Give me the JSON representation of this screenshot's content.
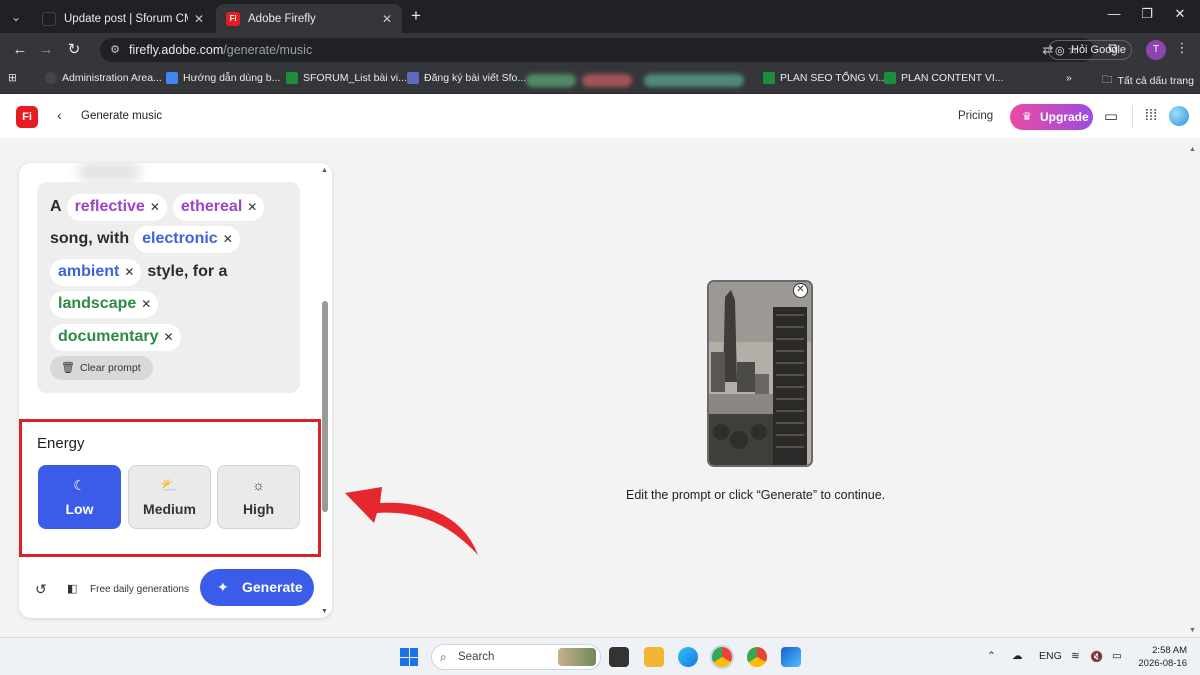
{
  "browser": {
    "tabs": [
      {
        "title": "Update post | Sforum CMS",
        "active": false
      },
      {
        "title": "Adobe Firefly",
        "active": true
      }
    ],
    "tab_favicon_ff": "Fi",
    "url_domain": "firefly.adobe.com",
    "url_path": "/generate/music",
    "ask_google": "Hỏi Google",
    "profile_initial": "T",
    "bookmarks": [
      "Administration Area...",
      "Hướng dẫn dùng b...",
      "SFORUM_List bài vi...",
      "Đăng ký bài viết Sfo...",
      "PLAN SEO TỔNG VI...",
      "PLAN CONTENT VI..."
    ],
    "bookmarks_more": "»",
    "all_bookmarks": "Tất cả dấu trang"
  },
  "app": {
    "logo": "Fi",
    "page_title": "Generate music",
    "pricing": "Pricing",
    "upgrade": "Upgrade"
  },
  "prompt": {
    "line1_word": "A",
    "chip_reflective": "reflective",
    "chip_ethereal": "ethereal",
    "line2_word": "song, with",
    "chip_electronic": "electronic",
    "chip_ambient": "ambient",
    "line3_word": "style, for a",
    "chip_landscape": "landscape",
    "chip_documentary": "documentary",
    "clear": "Clear prompt"
  },
  "energy": {
    "title": "Energy",
    "options": [
      "Low",
      "Medium",
      "High"
    ],
    "selected": "Low"
  },
  "footer": {
    "free": "Free daily generations",
    "generate": "Generate"
  },
  "main": {
    "message": "Edit the prompt or click “Generate” to continue."
  },
  "taskbar": {
    "search": "Search",
    "lang": "ENG",
    "time": "2:58 AM",
    "date": "2026-08-16"
  },
  "colors": {
    "accent_blue": "#3a5ce8",
    "chip_purple": "#9b45c9",
    "chip_blue": "#3e63d8",
    "chip_green": "#2d8a43",
    "highlight_red": "#d6232a"
  }
}
